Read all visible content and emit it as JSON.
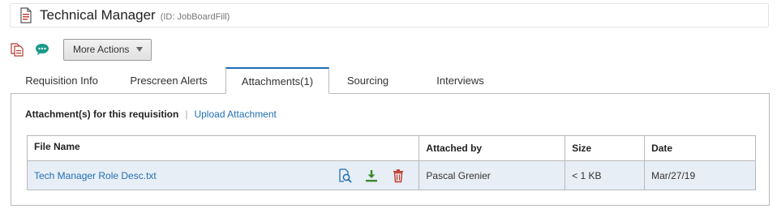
{
  "header": {
    "title": "Technical Manager",
    "id_label": "(ID: JobBoardFill)",
    "icon": "document-pdf-icon"
  },
  "toolbar": {
    "icons": [
      "copy-document-icon",
      "chat-bubble-icon"
    ],
    "more_actions_label": "More Actions"
  },
  "tabs": [
    {
      "label": "Requisition Info",
      "active": false
    },
    {
      "label": "Prescreen Alerts",
      "active": false
    },
    {
      "label": "Attachments(1)",
      "active": true
    },
    {
      "label": "Sourcing",
      "active": false
    },
    {
      "label": "Interviews",
      "active": false
    }
  ],
  "attachments": {
    "section_title": "Attachment(s) for this requisition",
    "separator": "|",
    "upload_label": "Upload Attachment",
    "columns": [
      "File Name",
      "Attached by",
      "Size",
      "Date"
    ],
    "rows": [
      {
        "file_name": "Tech Manager Role Desc.txt",
        "attached_by": "Pascal Grenier",
        "size": "< 1 KB",
        "date": "Mar/27/19",
        "row_actions": [
          "preview-icon",
          "download-icon",
          "trash-icon"
        ]
      }
    ]
  },
  "colors": {
    "accent": "#1f6fb5",
    "download": "#3c8a2e",
    "delete": "#c0392b",
    "row_bg": "#e8eef5",
    "chat": "#1a9a8a"
  }
}
